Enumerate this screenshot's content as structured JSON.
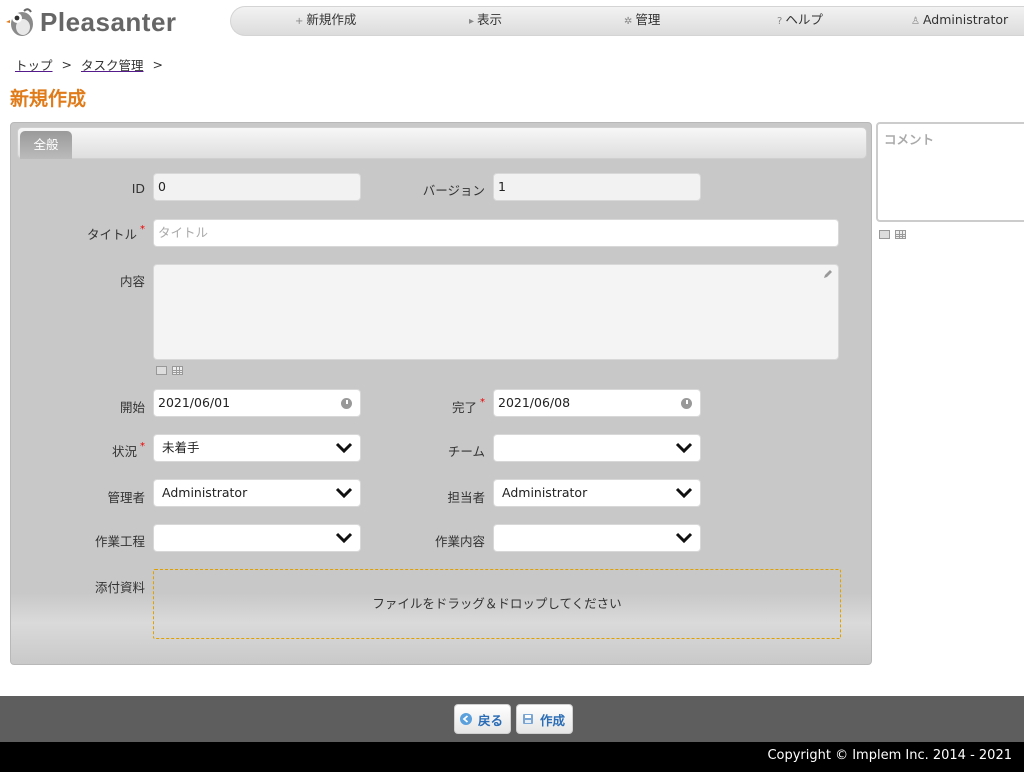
{
  "header": {
    "logo_text": "Pleasanter",
    "nav": [
      {
        "icon": "plus-icon",
        "glyph": "+",
        "label": "新規作成"
      },
      {
        "icon": "triangle-right-icon",
        "glyph": "▸",
        "label": "表示"
      },
      {
        "icon": "gear-icon",
        "glyph": "✲",
        "label": "管理"
      },
      {
        "icon": "help-icon",
        "glyph": "?",
        "label": "ヘルプ"
      },
      {
        "icon": "user-icon",
        "glyph": "♙",
        "label": "Administrator"
      }
    ]
  },
  "breadcrumb": {
    "items": [
      "トップ",
      "タスク管理"
    ],
    "separator": ">"
  },
  "page_title": "新規作成",
  "tabs": {
    "general": "全般"
  },
  "form": {
    "id": {
      "label": "ID",
      "value": "0"
    },
    "version": {
      "label": "バージョン",
      "value": "1"
    },
    "title": {
      "label": "タイトル",
      "required": "*",
      "placeholder": "タイトル"
    },
    "body": {
      "label": "内容"
    },
    "start": {
      "label": "開始",
      "value": "2021/06/01"
    },
    "complete": {
      "label": "完了",
      "required": "*",
      "value": "2021/06/08"
    },
    "status": {
      "label": "状況",
      "required": "*",
      "value": "未着手"
    },
    "team": {
      "label": "チーム",
      "value": ""
    },
    "manager": {
      "label": "管理者",
      "value": "Administrator"
    },
    "owner": {
      "label": "担当者",
      "value": "Administrator"
    },
    "process": {
      "label": "作業工程",
      "value": ""
    },
    "work": {
      "label": "作業内容",
      "value": ""
    },
    "attachments": {
      "label": "添付資料",
      "dropzone_text": "ファイルをドラッグ＆ドロップしてください"
    }
  },
  "comment": {
    "placeholder": "コメント"
  },
  "commands": {
    "back": "戻る",
    "create": "作成"
  },
  "footer": {
    "copyright": "Copyright © Implem Inc. 2014 - 2021"
  },
  "colors": {
    "title_accent": "#e07b1a",
    "button_text": "#2a6cb5",
    "required_mark": "#e00000"
  }
}
